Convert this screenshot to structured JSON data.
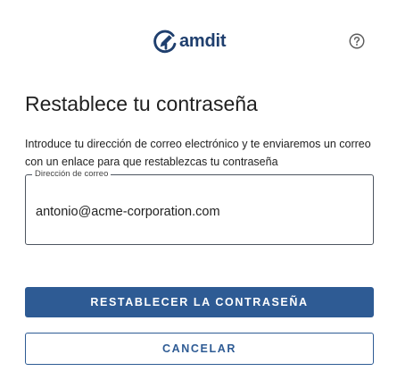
{
  "header": {
    "logo_text": "amdit",
    "logo_icon": "pencil-at-icon",
    "help_icon": "help-question-icon"
  },
  "main": {
    "title": "Restablece tu contraseña",
    "description": "Introduce tu dirección de correo electrónico y te enviaremos un correo con un enlace para que restablezcas tu contraseña",
    "email_field": {
      "label": "Dirección de correo",
      "value": "antonio@acme-corporation.com"
    },
    "reset_button_label": "RESTABLECER LA CONTRASEÑA",
    "cancel_button_label": "CANCELAR"
  },
  "colors": {
    "brand_primary": "#2e5b94",
    "logo_text": "#1f3f6e",
    "text": "#222222",
    "background": "#ffffff"
  }
}
